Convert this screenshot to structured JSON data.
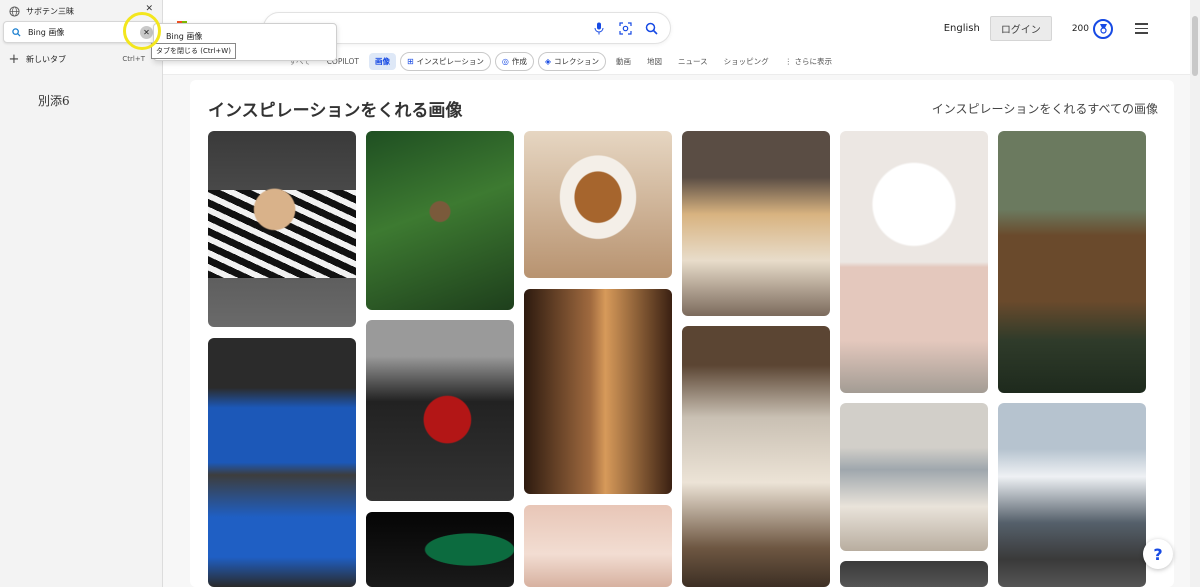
{
  "sidebar": {
    "tabs": [
      {
        "label": "サボテン三昧",
        "icon": "globe-icon"
      },
      {
        "label": "Bing 画像",
        "icon": "bing-search-icon"
      }
    ],
    "new_tab_label": "新しいタブ",
    "new_tab_shortcut": "Ctrl+T",
    "note": "別添6"
  },
  "tab_preview": {
    "title": "Bing 画像"
  },
  "tooltip": "タブを閉じる (Ctrl+W)",
  "header": {
    "search_value": "",
    "language": "English",
    "login": "ログイン",
    "points": "200"
  },
  "nav": {
    "items": [
      {
        "label": "COPILOT",
        "style": "plain"
      },
      {
        "label": "画像",
        "style": "active"
      },
      {
        "label": "インスピレーション",
        "style": "pill"
      },
      {
        "label": "作成",
        "style": "pill"
      },
      {
        "label": "コレクション",
        "style": "pill"
      },
      {
        "label": "動画",
        "style": "plain"
      },
      {
        "label": "地図",
        "style": "plain"
      },
      {
        "label": "ニュース",
        "style": "plain"
      },
      {
        "label": "ショッピング",
        "style": "plain"
      },
      {
        "label": "⋮ さらに表示",
        "style": "plain"
      }
    ],
    "first_item": "すべて"
  },
  "section": {
    "title": "インスピレーションをくれる画像",
    "see_all": "インスピレーションをくれるすべての画像"
  },
  "help_label": "?",
  "colors": {
    "accent": "#174ae4",
    "highlight_ring": "#f3e61d"
  }
}
